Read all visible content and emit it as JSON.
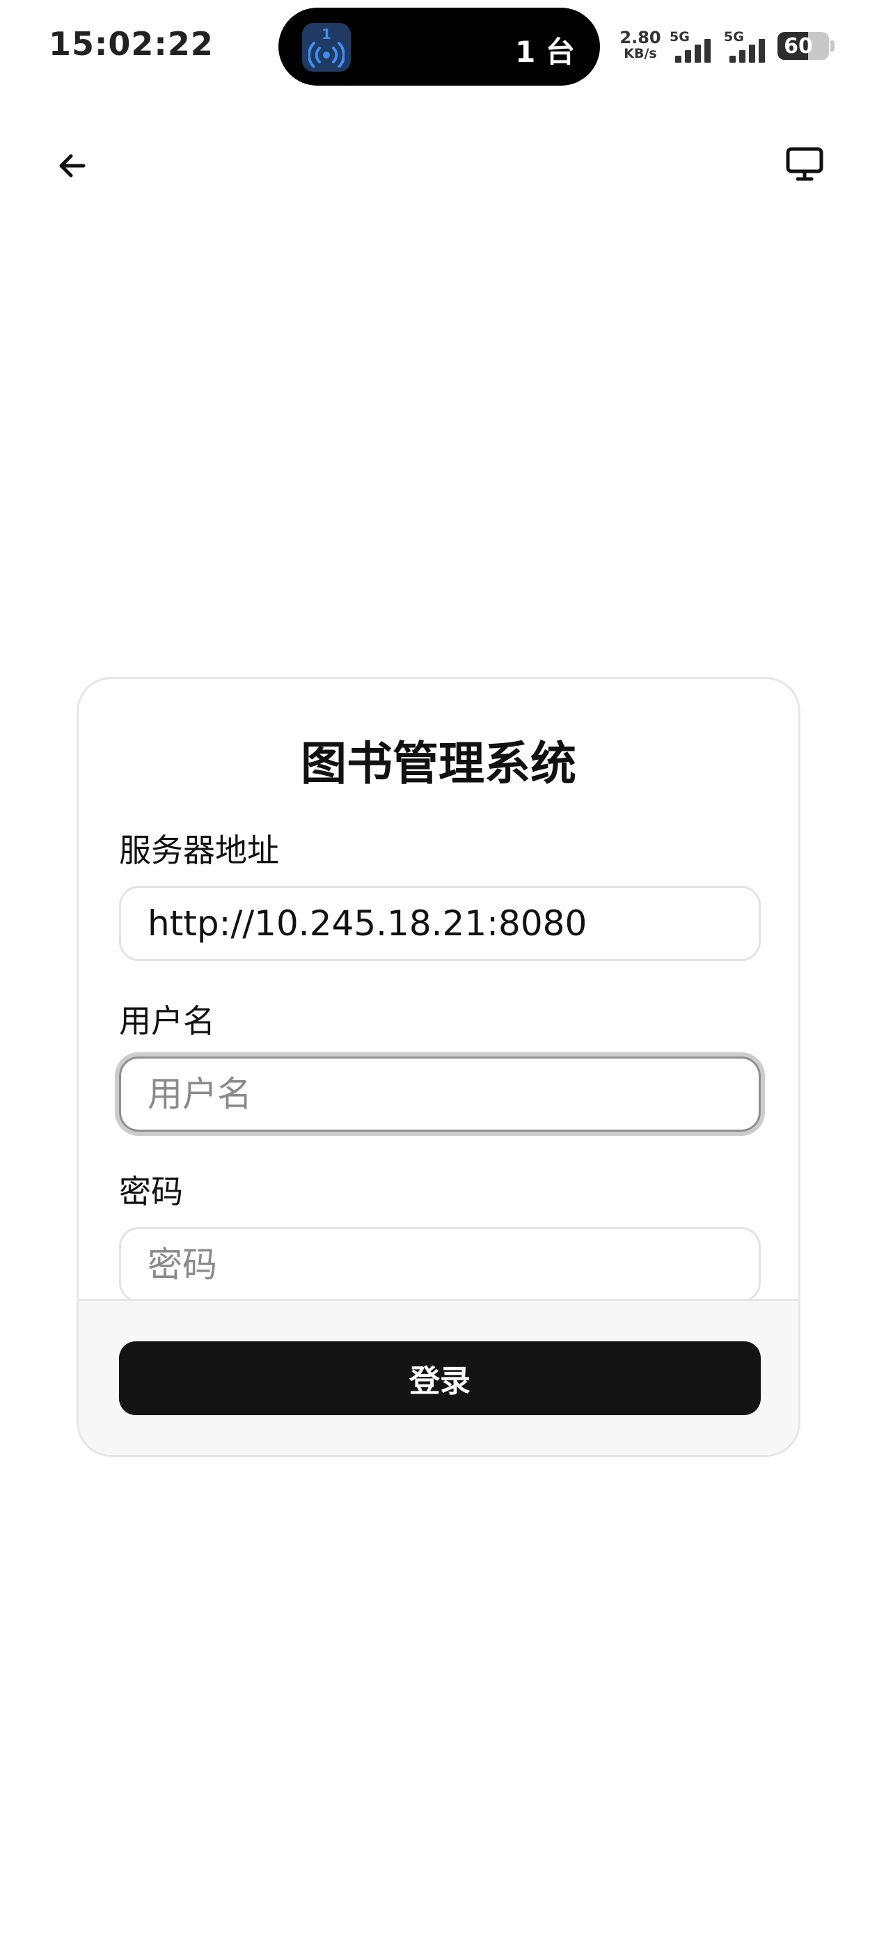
{
  "status_bar": {
    "time": "15:02:22",
    "island_badge": "1",
    "island_count": "1 台",
    "net_speed_value": "2.80",
    "net_speed_unit": "KB/s",
    "sim1_label": "5G",
    "sim2_label": "5G",
    "battery_level": "60",
    "battery_fraction": 0.6
  },
  "top_bar": {
    "back_icon": "arrow-left-icon",
    "desktop_icon": "monitor-icon"
  },
  "login": {
    "title": "图书管理系统",
    "server": {
      "label": "服务器地址",
      "value": "http://10.245.18.21:8080"
    },
    "username": {
      "label": "用户名",
      "placeholder": "用户名",
      "value": ""
    },
    "password": {
      "label": "密码",
      "placeholder": "密码",
      "value": ""
    },
    "submit_label": "登录"
  },
  "colors": {
    "button_bg": "#141414",
    "card_border": "#e6e6e6",
    "footer_bg": "#f7f7f7",
    "focus_ring": "#cccccc"
  }
}
